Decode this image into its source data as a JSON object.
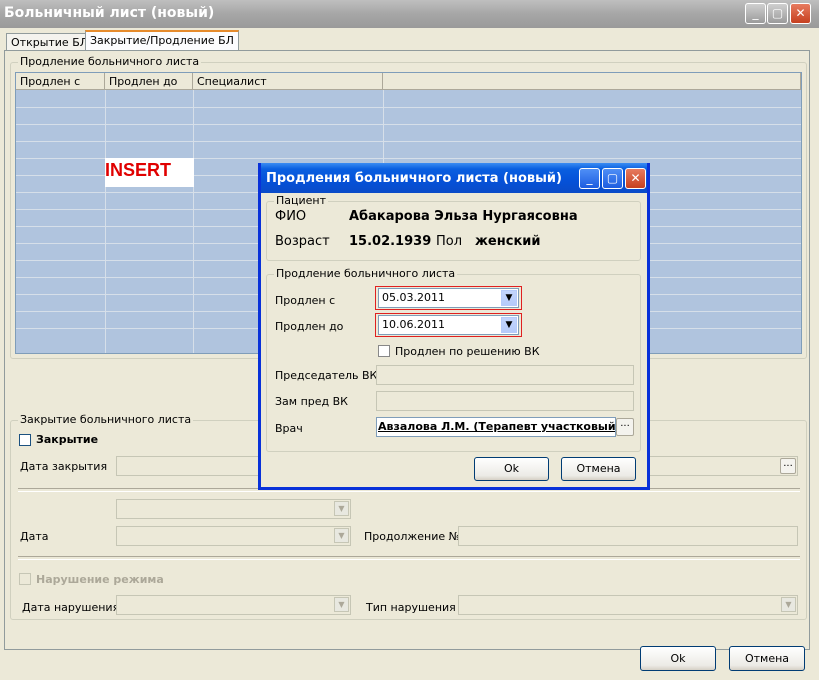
{
  "window": {
    "title": "Больничный лист (новый)"
  },
  "tabs": [
    {
      "label": "Открытие БЛ",
      "active": false
    },
    {
      "label": "Закрытие/Продление БЛ",
      "active": true
    }
  ],
  "extension_group": {
    "legend": "Продление больничного листа",
    "columns": [
      "Продлен с",
      "Продлен до",
      "Специалист"
    ],
    "insert_label": "INSERT"
  },
  "closing_group": {
    "legend": "Закрытие больничного листа",
    "closing_checkbox": {
      "label": "Закрытие",
      "checked": false
    },
    "close_date_label": "Дата закрытия",
    "date_label": "Дата",
    "continuation_label": "Продолжение №",
    "violation_checkbox": {
      "label": "Нарушение режима",
      "checked": false
    },
    "violation_date_label": "Дата нарушения",
    "violation_type_label": "Тип нарушения",
    "ellipsis": "..."
  },
  "footer": {
    "ok_label": "Ok",
    "cancel_label": "Отмена"
  },
  "dialog": {
    "title": "Продления больничного листа (новый)",
    "patient_legend": "Пациент",
    "fio_label": "ФИО",
    "fio_value": "Абакарова Эльза Нургаясовна",
    "age_label": "Возраст",
    "age_value": "15.02.1939",
    "sex_label": "Пол",
    "sex_value": "женский",
    "extension_legend": "Продление больничного листа",
    "from_label": "Продлен с",
    "from_value": "05.03.2011",
    "to_label": "Продлен до",
    "to_value": "10.06.2011",
    "vk_checkbox_label": "Продлен по решению ВК",
    "vk_checked": false,
    "chair_label": "Председатель ВК",
    "deputy_label": "Зам пред ВК",
    "doctor_label": "Врач",
    "doctor_value": "Авзалова Л.М. (Терапевт участковый)",
    "ellipsis": "...",
    "ok_label": "Ok",
    "cancel_label": "Отмена"
  },
  "colors": {
    "grid_bg": "#b0c4de",
    "insert_red": "#e00000",
    "dialog_title": "#0551d8",
    "highlight_frame": "#e02020"
  }
}
